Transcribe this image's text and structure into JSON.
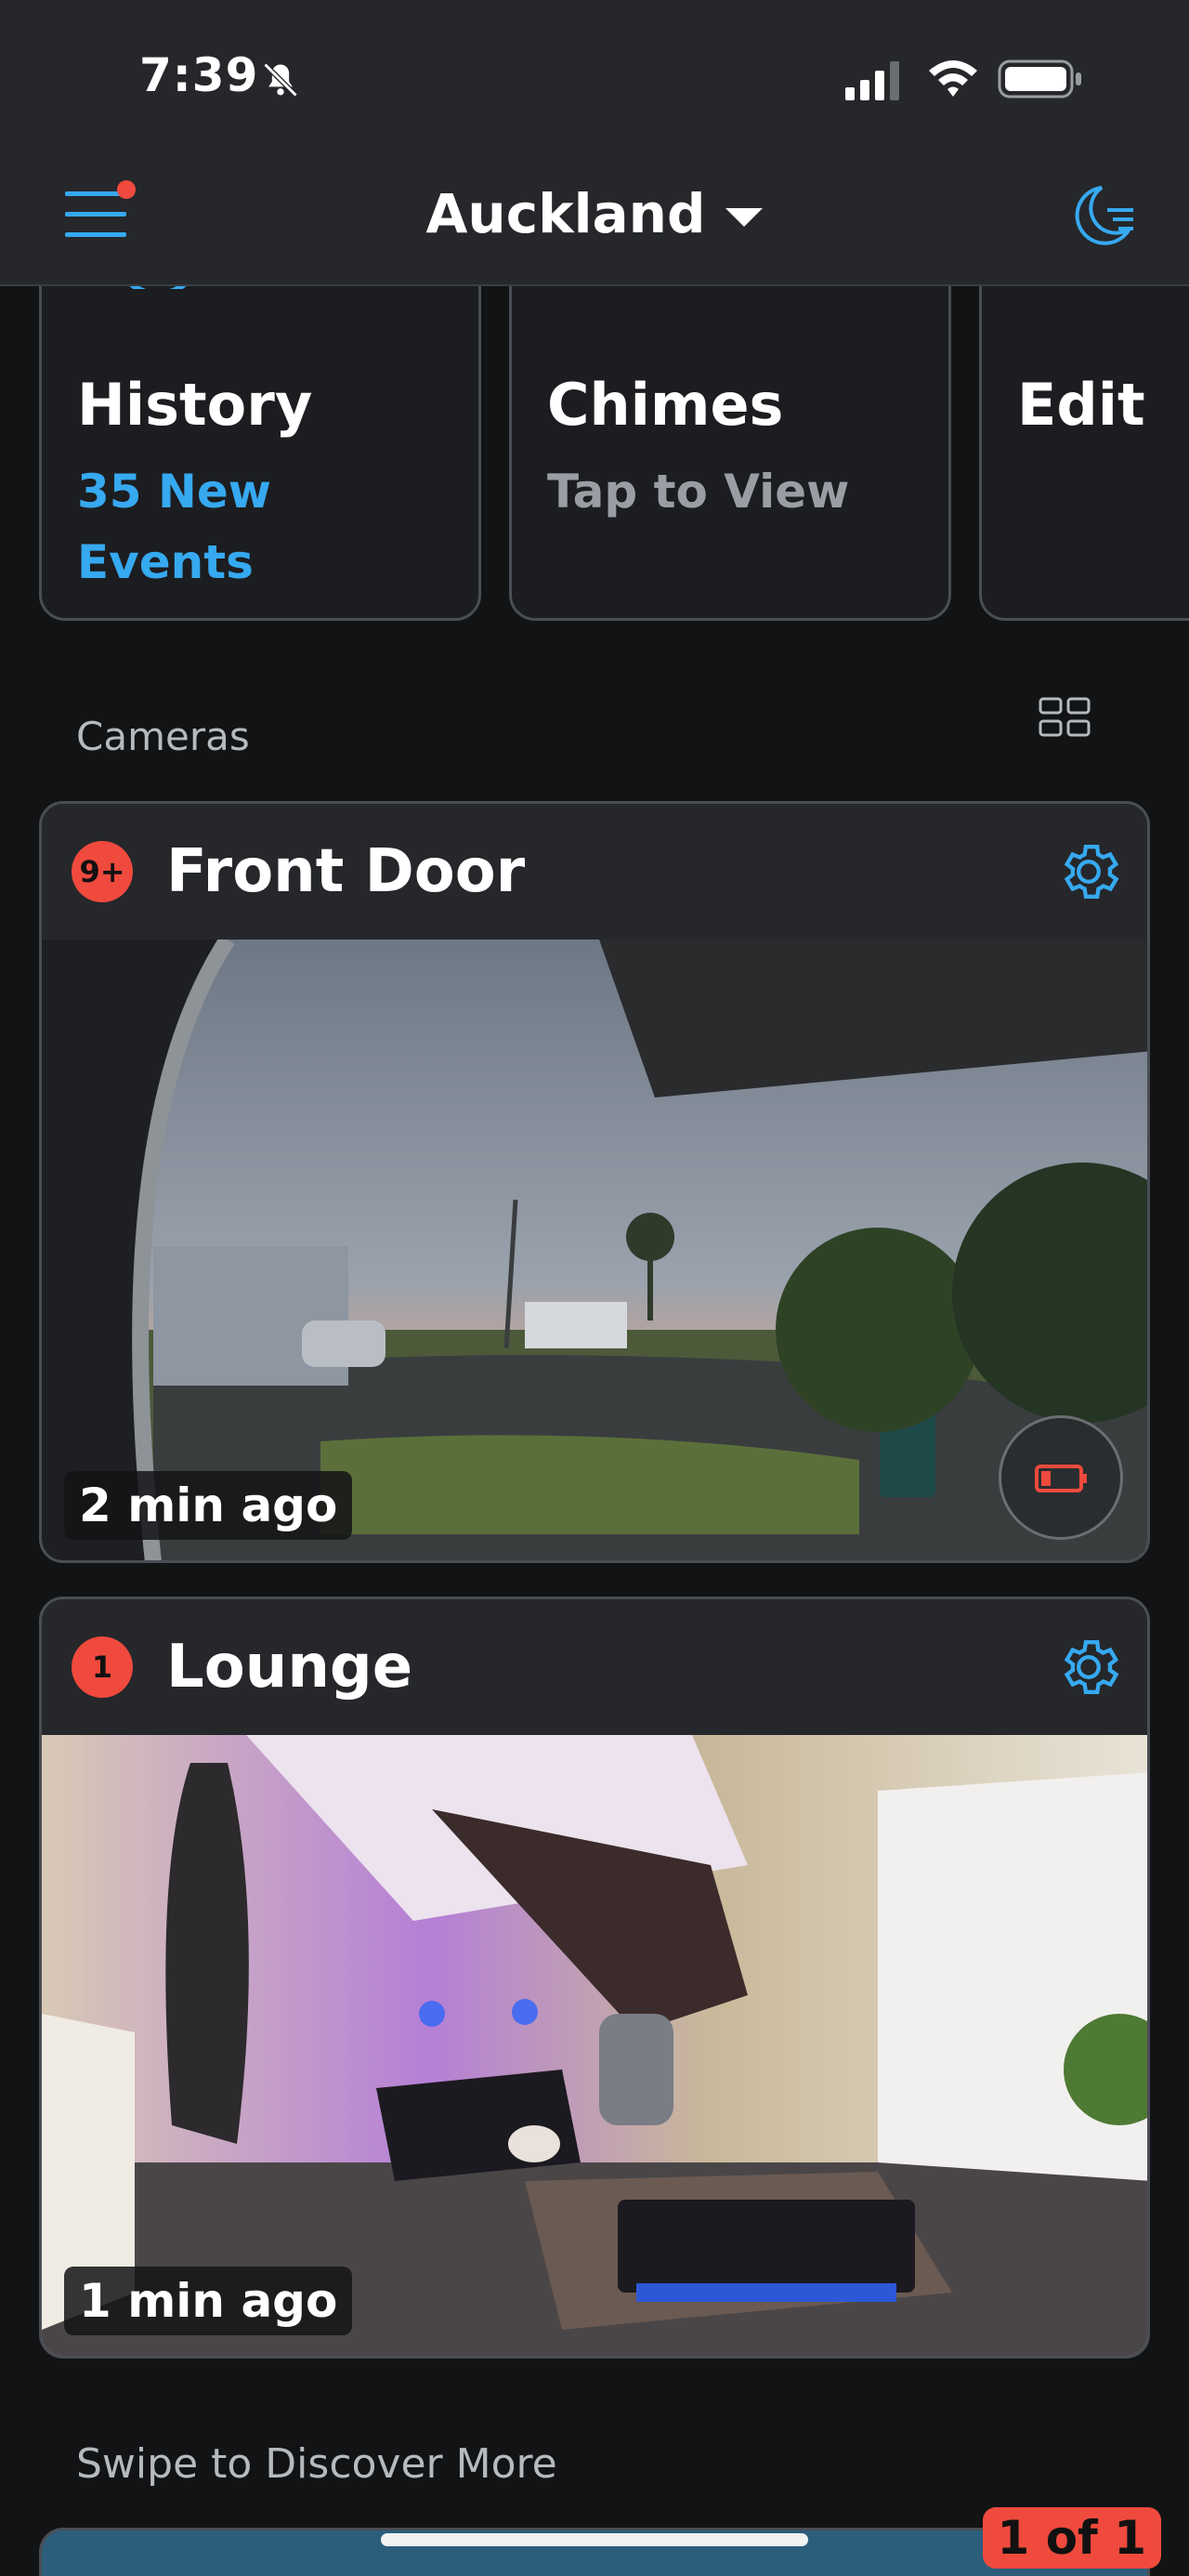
{
  "status_bar": {
    "time": "7:39"
  },
  "header": {
    "location": "Auckland"
  },
  "tiles": [
    {
      "title": "History",
      "subtitle": "35 New Events"
    },
    {
      "title": "Chimes",
      "subtitle": "Tap to View"
    },
    {
      "title": "Edit",
      "subtitle": ""
    }
  ],
  "cameras_section": {
    "label": "Cameras"
  },
  "cameras": [
    {
      "badge": "9+",
      "name": "Front Door",
      "timestamp": "2 min ago"
    },
    {
      "badge": "1",
      "name": "Lounge",
      "timestamp": "1 min ago"
    }
  ],
  "discover": {
    "label": "Swipe to Discover More",
    "pager": "1 of 1"
  },
  "colors": {
    "accent": "#36a9f0",
    "alert": "#ef4a3d",
    "background": "#121314",
    "surface": "#25272b"
  }
}
